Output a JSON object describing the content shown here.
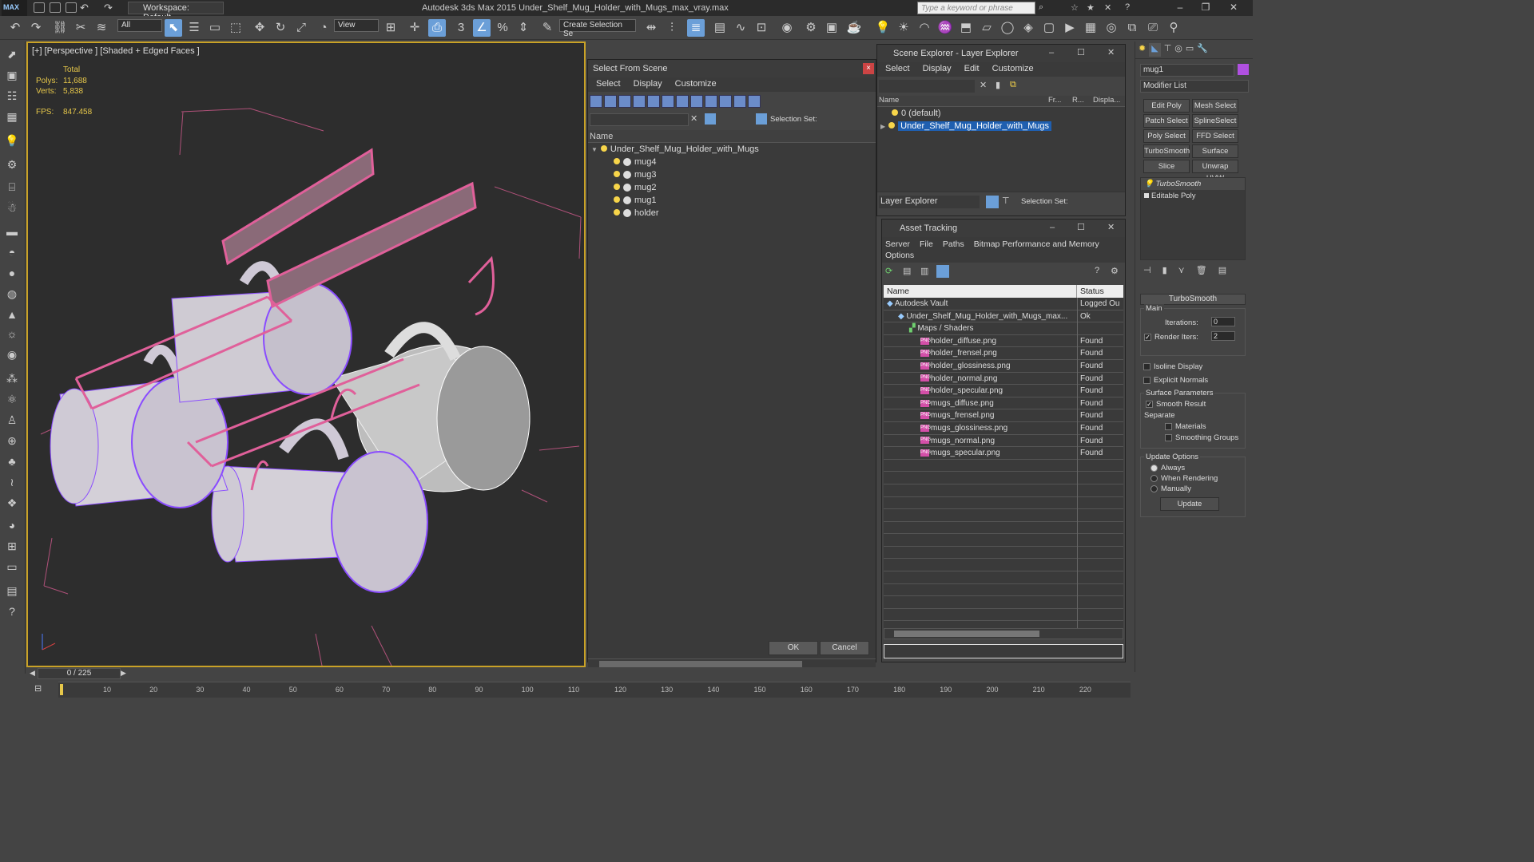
{
  "app": {
    "logo": "MAX",
    "workspace": "Workspace: Default",
    "title": "Autodesk 3ds Max  2015     Under_Shelf_Mug_Holder_with_Mugs_max_vray.max",
    "search_placeholder": "Type a keyword or phrase"
  },
  "toolbar": {
    "filter": "All",
    "refcoord": "View",
    "selset": "Create Selection Se",
    "snap": "3",
    "pct": "%"
  },
  "viewport": {
    "label": "[+] [Perspective ] [Shaded + Edged Faces ]",
    "stats_header": "Total",
    "polys_label": "Polys:",
    "polys": "11,688",
    "verts_label": "Verts:",
    "verts": "5,838",
    "fps_label": "FPS:",
    "fps": "847.458"
  },
  "sfs": {
    "title": "Select From Scene",
    "menu": [
      "Select",
      "Display",
      "Customize"
    ],
    "selset_label": "Selection Set:",
    "col_name": "Name",
    "root": "Under_Shelf_Mug_Holder_with_Mugs",
    "children": [
      "mug4",
      "mug3",
      "mug2",
      "mug1",
      "holder"
    ],
    "ok": "OK",
    "cancel": "Cancel"
  },
  "scene_explorer": {
    "title": "Scene Explorer - Layer Explorer",
    "menu": [
      "Select",
      "Display",
      "Edit",
      "Customize"
    ],
    "cols": [
      "Name",
      "Fr...",
      "R...",
      "Displa..."
    ],
    "rows": [
      "0 (default)",
      "Under_Shelf_Mug_Holder_with_Mugs"
    ],
    "footer_dd": "Layer Explorer",
    "footer_sel": "Selection Set:"
  },
  "asset": {
    "title": "Asset Tracking",
    "menu": [
      "Server",
      "File",
      "Paths",
      "Bitmap Performance and Memory",
      "Options"
    ],
    "col_name": "Name",
    "col_status": "Status",
    "rows": [
      {
        "name": "Autodesk Vault",
        "status": "Logged Ou",
        "indent": 0
      },
      {
        "name": "Under_Shelf_Mug_Holder_with_Mugs_max...",
        "status": "Ok",
        "indent": 1
      },
      {
        "name": "Maps / Shaders",
        "status": "",
        "indent": 2
      },
      {
        "name": "holder_diffuse.png",
        "status": "Found",
        "indent": 3
      },
      {
        "name": "holder_frensel.png",
        "status": "Found",
        "indent": 3
      },
      {
        "name": "holder_glossiness.png",
        "status": "Found",
        "indent": 3
      },
      {
        "name": "holder_normal.png",
        "status": "Found",
        "indent": 3
      },
      {
        "name": "holder_specular.png",
        "status": "Found",
        "indent": 3
      },
      {
        "name": "mugs_diffuse.png",
        "status": "Found",
        "indent": 3
      },
      {
        "name": "mugs_frensel.png",
        "status": "Found",
        "indent": 3
      },
      {
        "name": "mugs_glossiness.png",
        "status": "Found",
        "indent": 3
      },
      {
        "name": "mugs_normal.png",
        "status": "Found",
        "indent": 3
      },
      {
        "name": "mugs_specular.png",
        "status": "Found",
        "indent": 3
      }
    ]
  },
  "cmd": {
    "objname": "mug1",
    "modlist": "Modifier List",
    "buttons": [
      "Edit Poly",
      "Mesh Select",
      "Patch Select",
      "SplineSelect",
      "Poly Select",
      "FFD Select",
      "TurboSmooth",
      "Surface Select",
      "Slice",
      "Unwrap UVW"
    ],
    "stack": [
      "TurboSmooth",
      "Editable Poly"
    ],
    "ts": {
      "title": "TurboSmooth",
      "main": "Main",
      "iterations_label": "Iterations:",
      "iterations": "0",
      "render_iters_label": "Render Iters:",
      "render_iters": "2",
      "isoline": "Isoline Display",
      "explicit": "Explicit Normals",
      "surface": "Surface Parameters",
      "smooth": "Smooth Result",
      "separate": "Separate",
      "materials": "Materials",
      "smoothing": "Smoothing Groups",
      "update_opts": "Update Options",
      "always": "Always",
      "when_rendering": "When Rendering",
      "manually": "Manually",
      "update": "Update"
    }
  },
  "timeline": {
    "frame": "0 / 225",
    "ticks": [
      "10",
      "20",
      "30",
      "40",
      "50",
      "60",
      "70",
      "80",
      "90",
      "100",
      "110",
      "120",
      "130",
      "140",
      "150",
      "160",
      "170",
      "180",
      "190",
      "200",
      "210",
      "220"
    ]
  },
  "colors": {
    "accent": "#6b9fd8",
    "selection": "#1f5fb0",
    "wire_pink": "#e0609a",
    "wire_purple": "#8040ff",
    "bulb": "#f7d54a"
  }
}
